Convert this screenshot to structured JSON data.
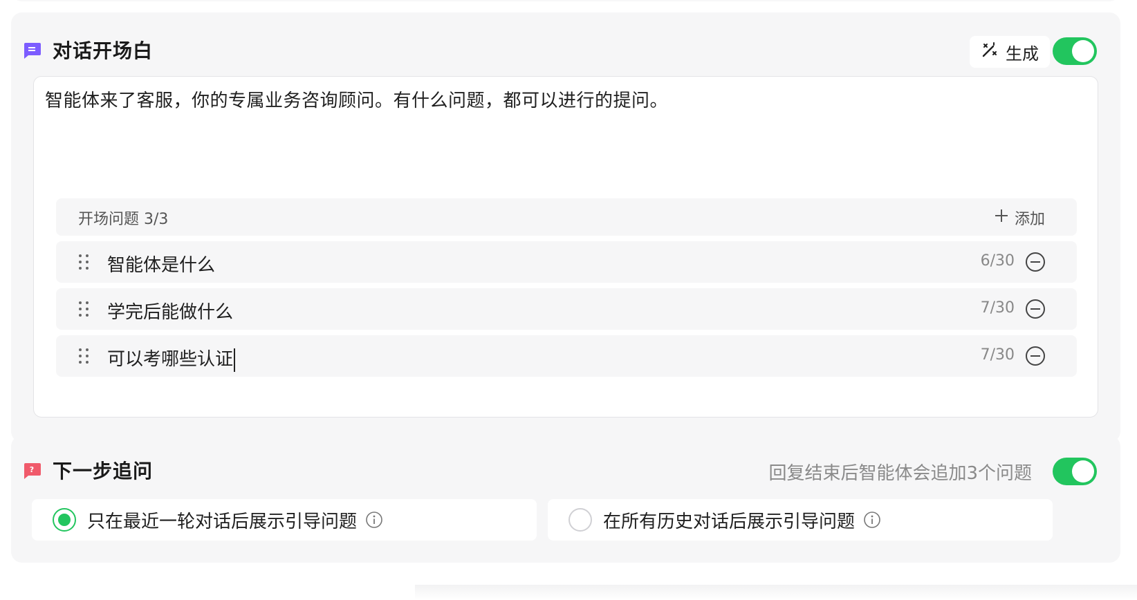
{
  "opening": {
    "title": "对话开场白",
    "generate_label": "生成",
    "enabled": true,
    "text": "智能体来了客服，你的专属业务咨询顾问。有什么问题，都可以进行的提问。",
    "questions_label": "开场问题 3/3",
    "add_label": "添加",
    "questions": [
      {
        "text": "智能体是什么",
        "count": "6/30"
      },
      {
        "text": "学完后能做什么",
        "count": "7/30"
      },
      {
        "text": "可以考哪些认证",
        "count": "7/30"
      }
    ]
  },
  "followup": {
    "title": "下一步追问",
    "hint": "回复结束后智能体会追加3个问题",
    "enabled": true,
    "options": [
      {
        "label": "只在最近一轮对话后展示引导问题",
        "selected": true
      },
      {
        "label": "在所有历史对话后展示引导问题",
        "selected": false
      }
    ]
  },
  "colors": {
    "accent_green": "#22c55e",
    "opening_icon": "#7c5cff",
    "followup_icon": "#f05a6b"
  }
}
